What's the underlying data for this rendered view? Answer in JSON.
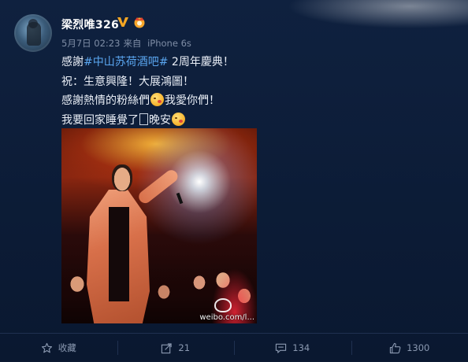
{
  "post": {
    "username": "梁烈唯326",
    "date": "5月7日 02:23",
    "source_prefix": "来自",
    "source": "iPhone 6s",
    "lines": {
      "l1_prefix": "感謝",
      "l1_hashtag": "#中山苏荷酒吧#",
      "l1_suffix": " 2周年慶典！",
      "l2": "祝：生意興隆！大展鴻圖！",
      "l3_prefix": "感謝熱情的粉絲們",
      "l3_suffix": "我愛你們！",
      "l4_prefix": "我要回家睡覺了",
      "l4_suffix": "晚安"
    },
    "image_watermark": "weibo.com/l..."
  },
  "actions": {
    "favorite_label": "收藏",
    "repost_count": "21",
    "comment_count": "134",
    "like_count": "1300"
  },
  "icons": {
    "verified": "verified-v-badge-icon",
    "vip": "vip-crown-icon",
    "favorite": "star-icon",
    "repost": "share-arrow-icon",
    "comment": "comment-bubble-icon",
    "like": "thumbs-up-icon",
    "emoji": "blowing-kiss-emoji"
  },
  "colors": {
    "background": "#0c1b33",
    "hashtag": "#5aa6f0",
    "verified": "#f5a623",
    "muted": "#8a98b0"
  }
}
